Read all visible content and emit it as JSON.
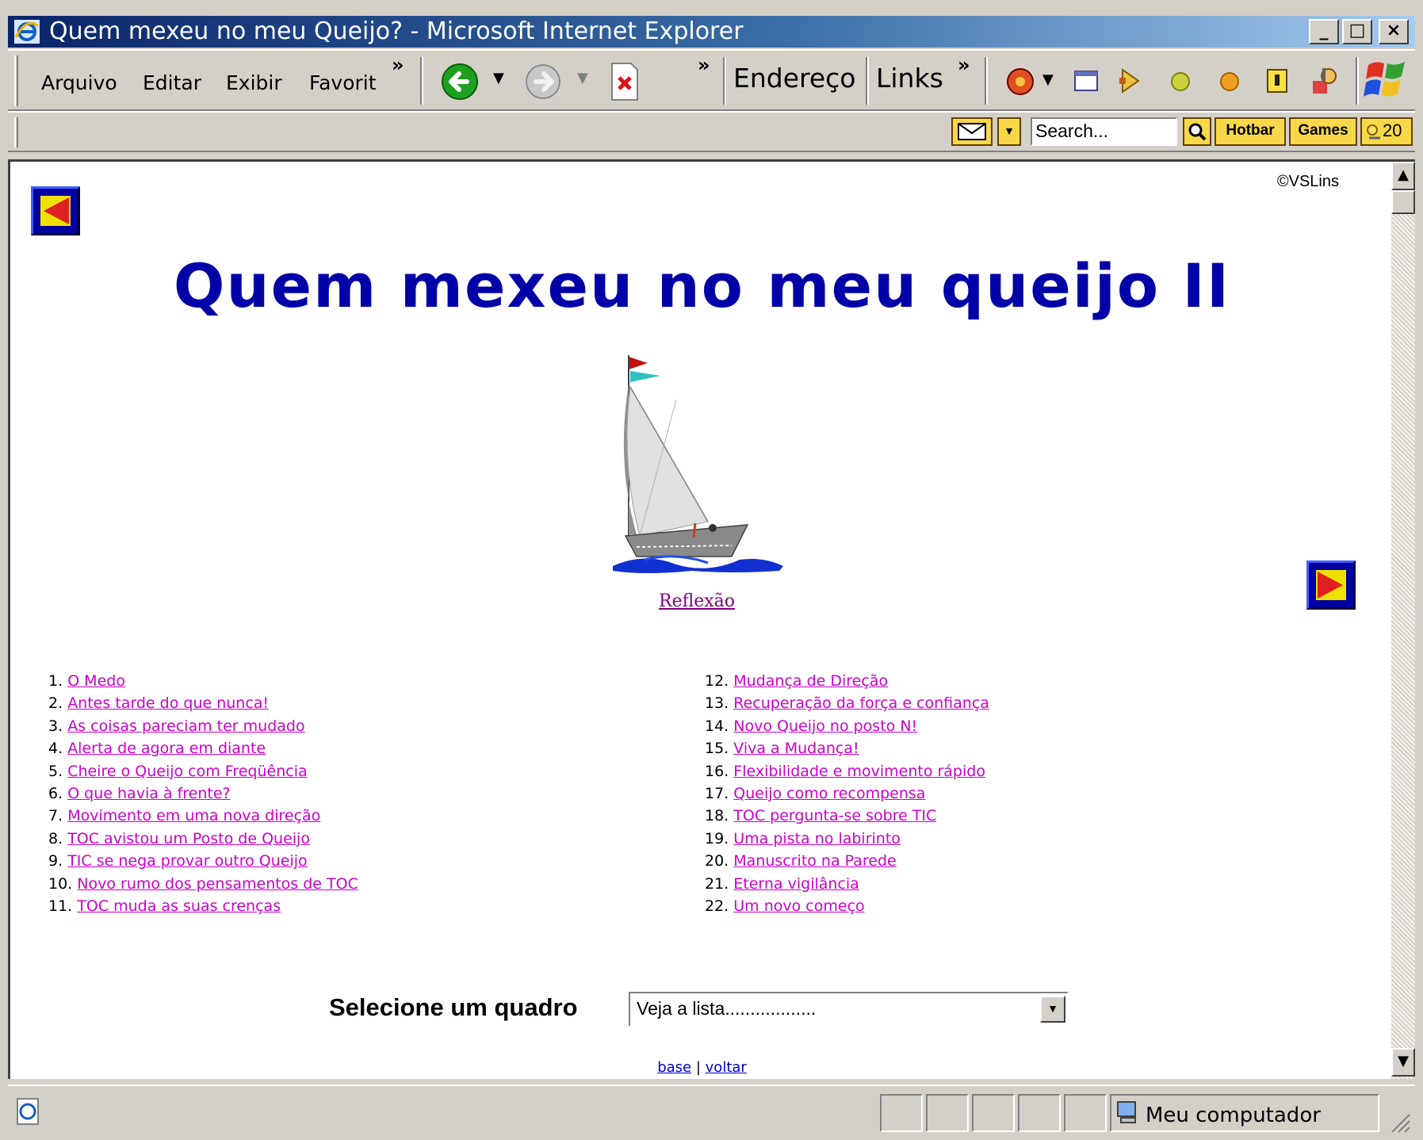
{
  "window": {
    "title": "Quem mexeu no meu Queijo? - Microsoft Internet Explorer",
    "minimize": "_",
    "maximize": "□",
    "close": "×"
  },
  "menu": {
    "items": [
      "Arquivo",
      "Editar",
      "Exibir",
      "Favorit"
    ],
    "overflow": "»"
  },
  "toolbar": {
    "overflow": "»",
    "address_label": "Endereço",
    "links_label": "Links",
    "links_overflow": "»"
  },
  "hotbar": {
    "search_placeholder": "Search...",
    "hotbar_label": "Hotbar",
    "games_label": "Games",
    "weather_label": "20"
  },
  "page": {
    "copyright": "©VSLins",
    "heading": "Quem mexeu no meu queijo II",
    "image_link": "Reflexão",
    "toc_left": [
      {
        "num": "1.",
        "label": "O Medo"
      },
      {
        "num": "2.",
        "label": "Antes tarde do que nunca!"
      },
      {
        "num": "3.",
        "label": "As coisas pareciam ter mudado"
      },
      {
        "num": "4.",
        "label": "Alerta de agora em diante"
      },
      {
        "num": "5.",
        "label": "Cheire o Queijo com Freqüência"
      },
      {
        "num": "6.",
        "label": "O que havia à frente?"
      },
      {
        "num": "7.",
        "label": "Movimento em uma nova direção"
      },
      {
        "num": "8.",
        "label": "TOC avistou um Posto de Queijo"
      },
      {
        "num": "9.",
        "label": "TIC se nega provar outro Queijo"
      },
      {
        "num": "10.",
        "label": "Novo rumo dos pensamentos de TOC"
      },
      {
        "num": "11.",
        "label": "TOC muda as suas crenças"
      }
    ],
    "toc_right": [
      {
        "num": "12.",
        "label": "Mudança de Direção"
      },
      {
        "num": "13.",
        "label": "Recuperação da força e confiança"
      },
      {
        "num": "14.",
        "label": "Novo Queijo no posto N!"
      },
      {
        "num": "15.",
        "label": "Viva a Mudança!"
      },
      {
        "num": "16.",
        "label": "Flexibilidade e movimento rápido"
      },
      {
        "num": "17.",
        "label": "Queijo como recompensa"
      },
      {
        "num": "18.",
        "label": "TOC pergunta-se sobre TIC"
      },
      {
        "num": "19.",
        "label": "Uma pista no labirinto"
      },
      {
        "num": "20.",
        "label": "Manuscrito na Parede"
      },
      {
        "num": "21.",
        "label": "Eterna vigilância"
      },
      {
        "num": "22.",
        "label": "Um novo começo"
      }
    ],
    "select_label": "Selecione um quadro",
    "select_value": "Veja a lista..................",
    "footer_base": "base",
    "footer_sep": "|",
    "footer_voltar": "voltar"
  },
  "status": {
    "zone": "Meu computador"
  }
}
